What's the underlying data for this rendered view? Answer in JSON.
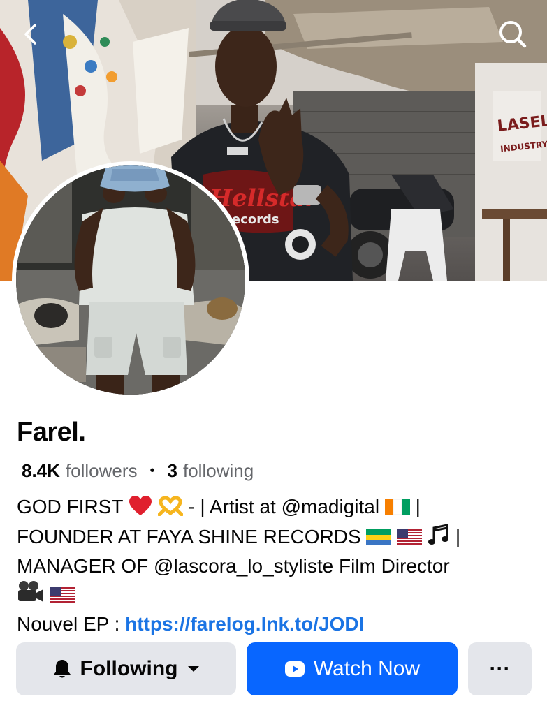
{
  "navigation": {
    "back_icon": "chevron-left-icon",
    "search_icon": "search-icon"
  },
  "cover": {
    "sign_text_1": "LASEL",
    "sign_text_2": "INDUSTRY",
    "shirt_text_1": "Hellstar",
    "shirt_text_2": "Records"
  },
  "profile": {
    "name": "Farel.",
    "followers_count": "8.4K",
    "followers_label": "followers",
    "separator": "•",
    "following_count": "3",
    "following_label": "following"
  },
  "bio": {
    "line1_a": "GOD FIRST",
    "line1_b": "- |  Artist at @madigital",
    "line1_c": "|",
    "line2_a": "FOUNDER AT FAYA SHINE RECORDS",
    "line2_b": "|",
    "line3": "MANAGER OF @lascora_lo_styliste Film Director",
    "line5_label": "Nouvel EP :",
    "link": "https://farelog.lnk.to/JODI"
  },
  "actions": {
    "following_label": "Following",
    "watch_label": "Watch Now",
    "more_label": "···"
  },
  "colors": {
    "accent": "#0866ff",
    "link": "#1b74e4",
    "button_gray": "#e4e6eb",
    "secondary_text": "#65676b"
  }
}
